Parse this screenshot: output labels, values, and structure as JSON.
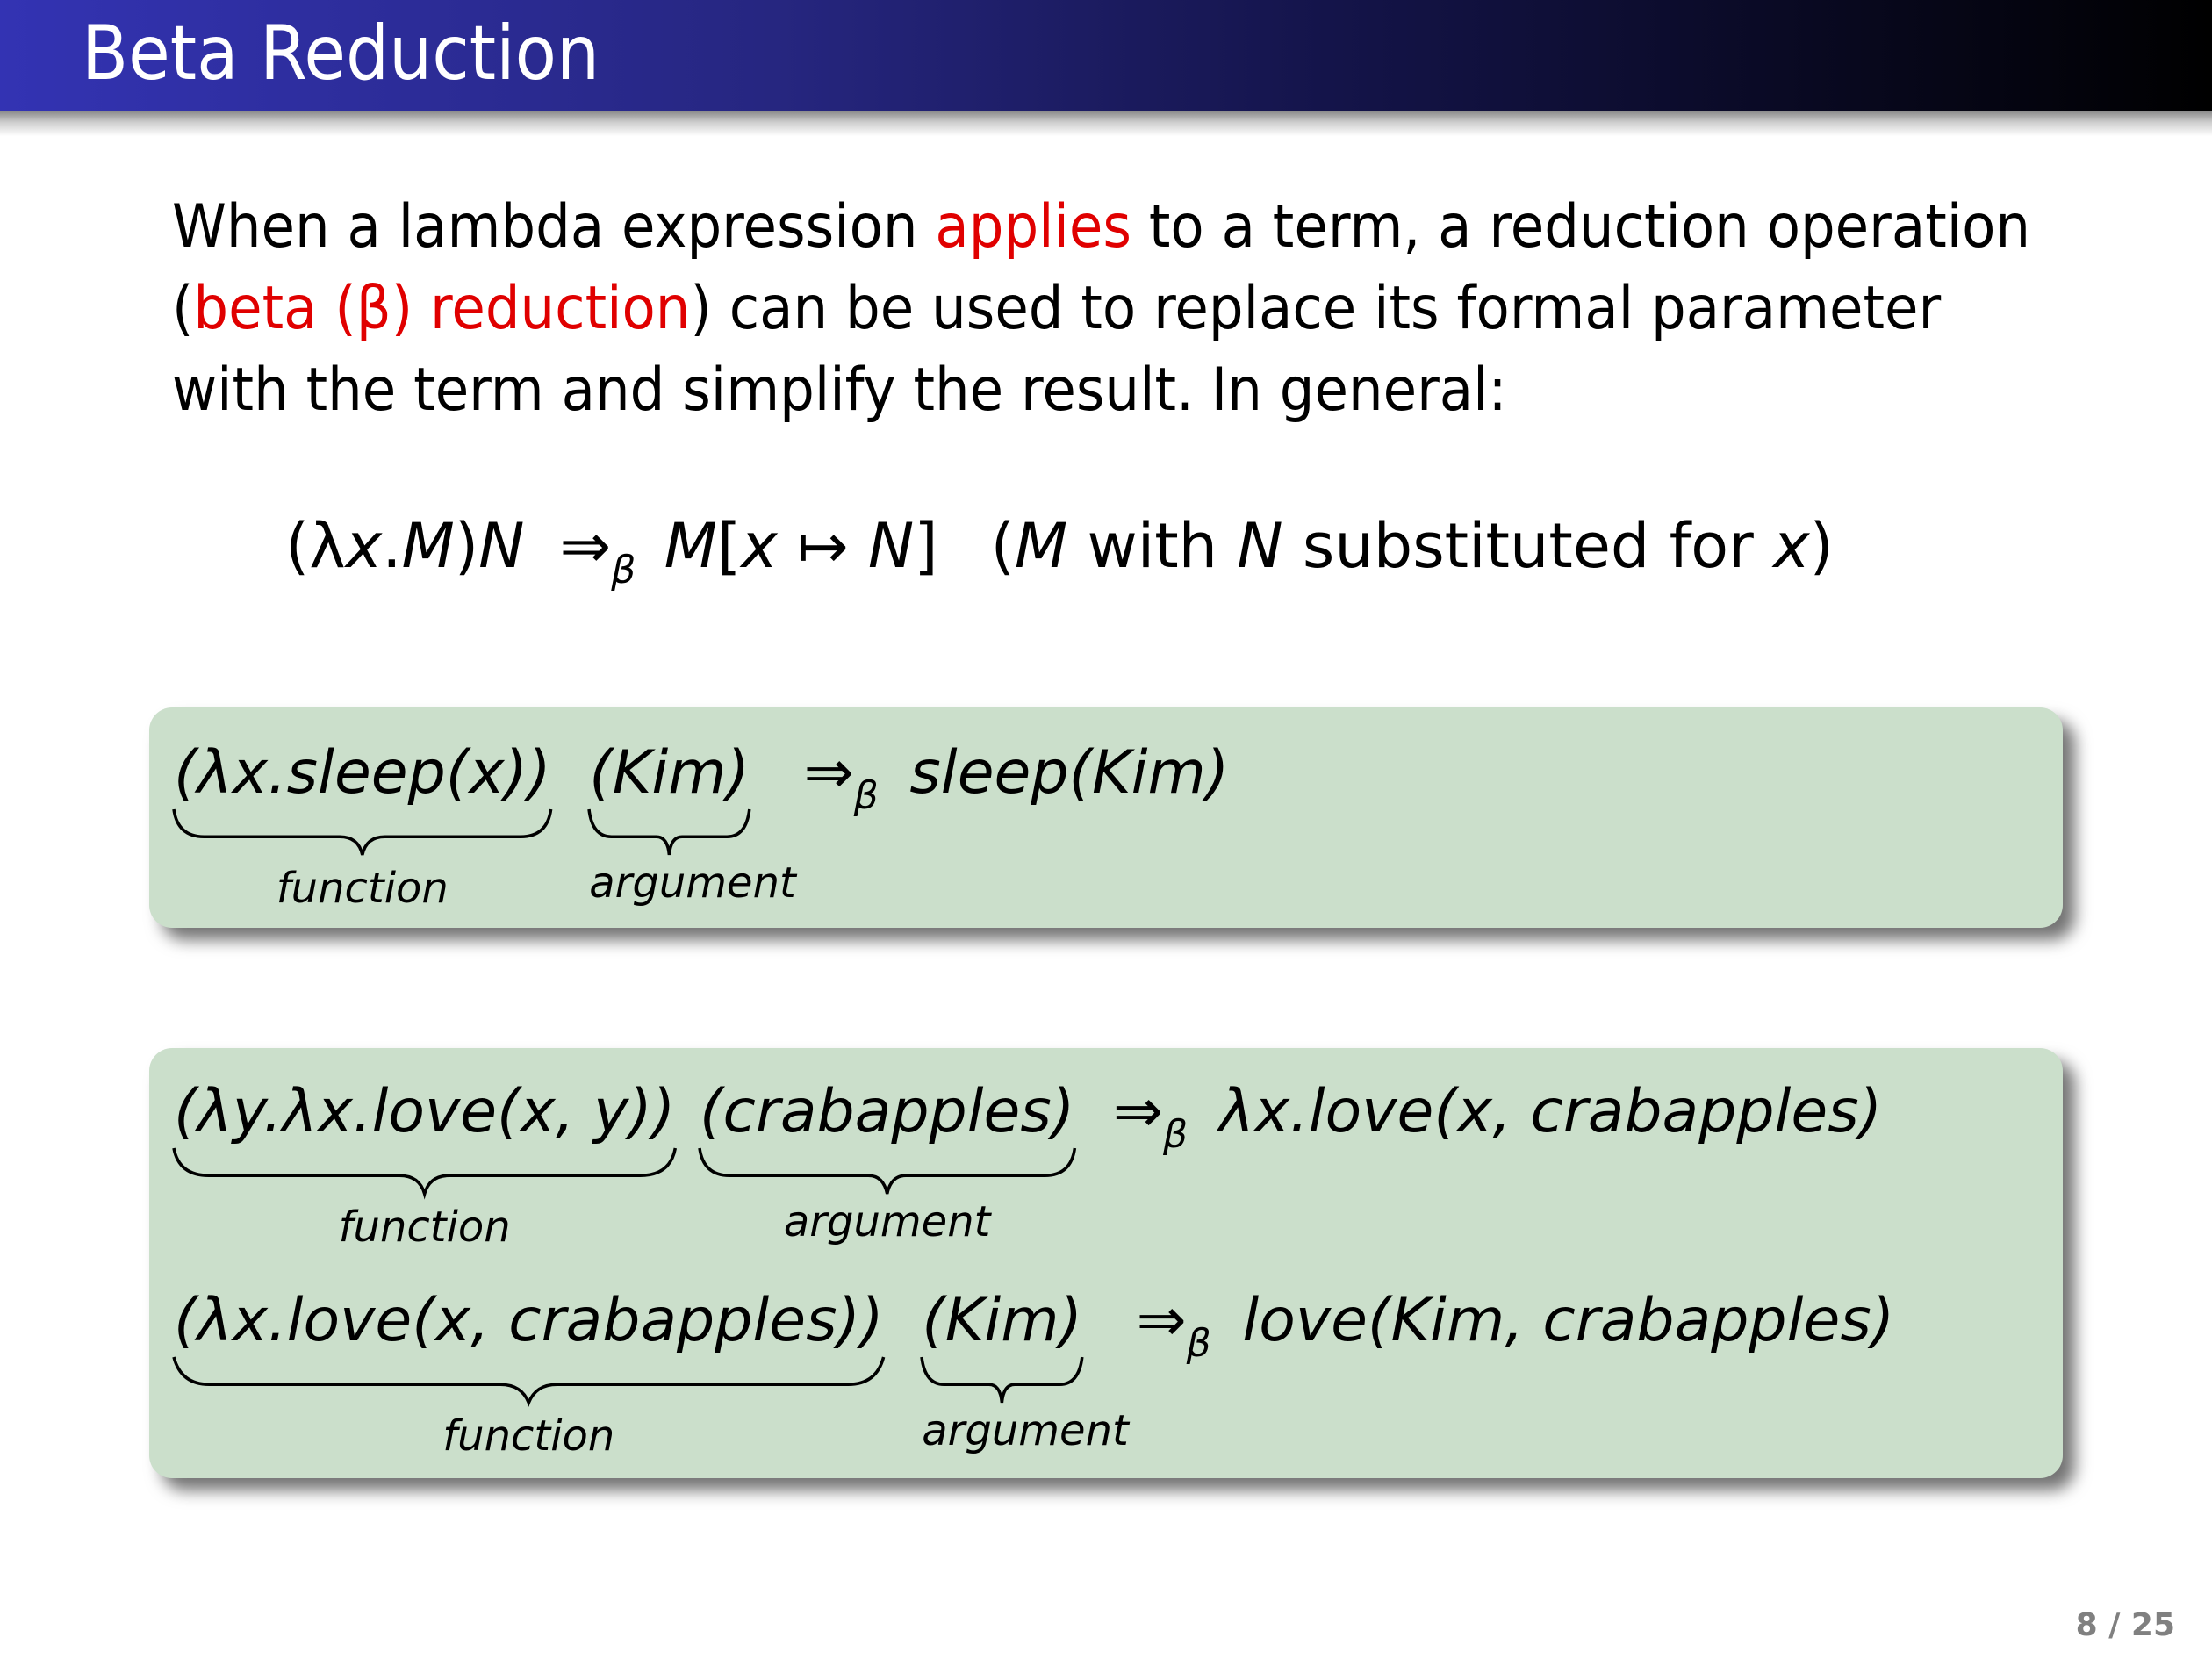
{
  "slide": {
    "title": "Beta Reduction",
    "page_number": "8 / 25",
    "current_page": 8,
    "total_pages": 25,
    "colors": {
      "header_gradient_start": "#3333b3",
      "header_gradient_end": "#000000",
      "highlight_red": "#e00000",
      "example_box_bg": "#cbdfcb",
      "page_number_gray": "#808080"
    }
  },
  "intro": {
    "line1_pre": "When a lambda expression ",
    "line1_red": "applies",
    "line1_post": " to a term, a reduction operation",
    "line2_open": "(",
    "line2_red": "beta (β) reduction",
    "line2_post": ") can be used to replace its formal parameter",
    "line3": "with the term and simplify the result. In general:"
  },
  "general_formula": {
    "lhs_open": "(λ",
    "lhs_var": "x",
    "lhs_dot": ".",
    "lhs_body": "M",
    "lhs_close": ")",
    "lhs_arg": "N",
    "arrow": "⇒",
    "arrow_sub": "β",
    "rhs_M": "M",
    "rhs_open": "[",
    "rhs_x": "x",
    "rhs_maps": " ↦ ",
    "rhs_N": "N",
    "rhs_close": "]",
    "gloss_open": "(",
    "gloss_M": "M",
    "gloss_with": " with ",
    "gloss_N": "N",
    "gloss_sub": " substituted for ",
    "gloss_x": "x",
    "gloss_close": ")"
  },
  "examples": [
    {
      "steps": [
        {
          "function": "(λx.sleep(x))",
          "argument": "(Kim)",
          "arrow": "⇒",
          "arrow_sub": "β",
          "result": "sleep(Kim)",
          "function_label": "function",
          "argument_label": "argument"
        }
      ]
    },
    {
      "steps": [
        {
          "function": "(λy.λx.love(x, y))",
          "argument": "(crabapples)",
          "arrow": "⇒",
          "arrow_sub": "β",
          "result": "λx.love(x, crabapples)",
          "function_label": "function",
          "argument_label": "argument"
        },
        {
          "function": "(λx.love(x, crabapples))",
          "argument": "(Kim)",
          "arrow": "⇒",
          "arrow_sub": "β",
          "result": "love(Kim, crabapples)",
          "function_label": "function",
          "argument_label": "argument"
        }
      ]
    }
  ]
}
